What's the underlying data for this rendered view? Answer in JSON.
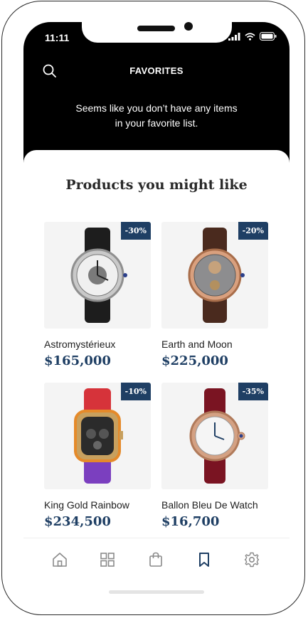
{
  "status_bar": {
    "time": "11:11"
  },
  "header": {
    "title": "FAVORITES",
    "empty_message_line1": "Seems like you don’t have any items",
    "empty_message_line2": "in your favorite list."
  },
  "suggestions": {
    "title": "Products you might like",
    "products": [
      {
        "name": "Astromystérieux",
        "price": "$165,000",
        "discount": "-30%",
        "strap_color": "#1d1d1d",
        "case_color": "#c9c9c9"
      },
      {
        "name": "Earth and Moon",
        "price": "$225,000",
        "discount": "-20%",
        "strap_color": "#4a2a1e",
        "case_color": "#d9a07e"
      },
      {
        "name": "King Gold Rainbow",
        "price": "$234,500",
        "discount": "-10%",
        "strap_color": "#d6333a",
        "case_color": "#c8a05e"
      },
      {
        "name": "Ballon Bleu De Watch",
        "price": "$16,700",
        "discount": "-35%",
        "strap_color": "#7a1422",
        "case_color": "#d4a183"
      }
    ]
  },
  "tab_bar": {
    "items": [
      "home-icon",
      "grid-icon",
      "bag-icon",
      "bookmark-icon",
      "settings-icon"
    ],
    "active": "bookmark-icon",
    "active_color": "#1f3f64",
    "inactive_color": "#8a8a8a"
  },
  "accent": "#1f3f64"
}
